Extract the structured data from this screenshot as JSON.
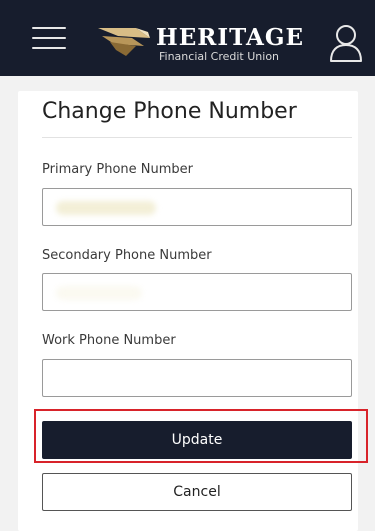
{
  "header": {
    "brand_name": "HERITAGE",
    "brand_sub": "Financial Credit Union",
    "bg_color": "#171d2d",
    "logo_accent": "#c9a96e",
    "menu_icon": "hamburger-menu-icon",
    "user_icon": "user-account-icon"
  },
  "form": {
    "title": "Change Phone Number",
    "fields": [
      {
        "label": "Primary Phone Number",
        "value": "",
        "placeholder": ""
      },
      {
        "label": "Secondary Phone Number",
        "value": "",
        "placeholder": ""
      },
      {
        "label": "Work Phone Number",
        "value": "",
        "placeholder": ""
      }
    ],
    "update_label": "Update",
    "cancel_label": "Cancel",
    "highlight_color": "#d8232a"
  }
}
